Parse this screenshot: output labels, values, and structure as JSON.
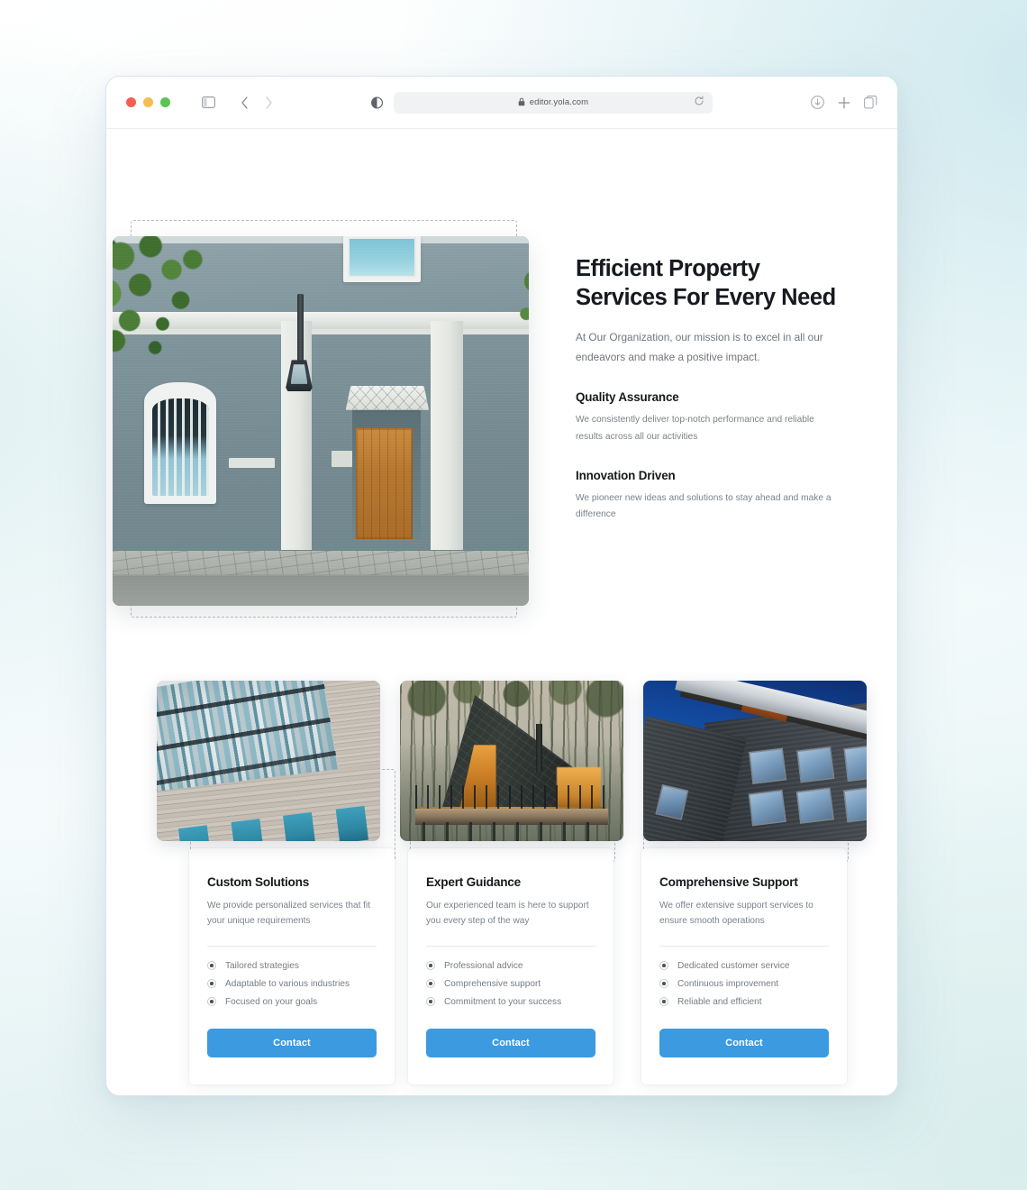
{
  "browser": {
    "url": "editor.yola.com",
    "icons": {
      "sidebar": "sidebar-toggle-icon",
      "back": "back-arrow-icon",
      "forward": "forward-arrow-icon",
      "reader": "reader-view-icon",
      "lock": "lock-icon",
      "reload": "reload-icon",
      "download": "download-icon",
      "new_tab": "plus-icon",
      "tab_overview": "tab-overview-icon"
    }
  },
  "hero": {
    "title": "Efficient Property Services For Every Need",
    "subtitle": "At Our Organization, our mission is to excel in all our endeavors and make a positive impact.",
    "image_alt": "blue-grey-building-facade-with-wooden-door",
    "features": [
      {
        "title": "Quality Assurance",
        "body": "We consistently deliver top-notch performance and reliable results across all our activities"
      },
      {
        "title": "Innovation Driven",
        "body": "We pioneer new ideas and solutions to stay ahead and make a difference"
      }
    ]
  },
  "cards": [
    {
      "image_alt": "modern-glass-and-stone-office-building",
      "title": "Custom Solutions",
      "desc": "We provide personalized services that fit your unique requirements",
      "items": [
        "Tailored strategies",
        "Adaptable to various industries",
        "Focused on your goals"
      ],
      "cta": "Contact"
    },
    {
      "image_alt": "a-frame-cabin-in-pine-forest",
      "title": "Expert Guidance",
      "desc": "Our experienced team is here to support you every step of the way",
      "items": [
        "Professional advice",
        "Comprehensive support",
        "Commitment to your success"
      ],
      "cta": "Contact"
    },
    {
      "image_alt": "dark-brick-apartment-building-against-blue-sky",
      "title": "Comprehensive Support",
      "desc": "We offer extensive support services to ensure smooth operations",
      "items": [
        "Dedicated customer service",
        "Continuous improvement",
        "Reliable and efficient"
      ],
      "cta": "Contact"
    }
  ],
  "colors": {
    "accent": "#3c9ae0",
    "heading": "#16191d",
    "body_text": "#7b8289",
    "selection_outline": "#b9bec3",
    "page_background": "#eef7f7"
  }
}
